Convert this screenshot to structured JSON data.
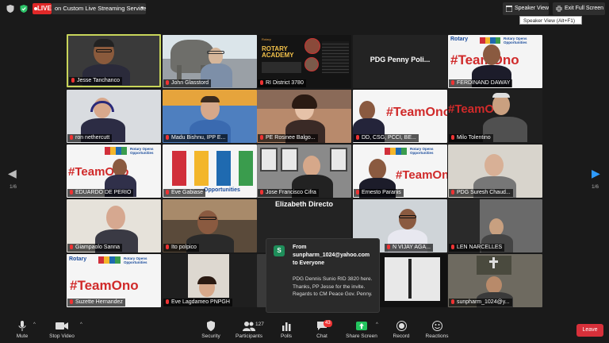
{
  "topbar": {
    "live_badge": "LIVE",
    "stream_label": "on Custom Live Streaming Service",
    "speaker_view_label": "Speaker View",
    "exit_full_screen_label": "Exit Full Screen",
    "tooltip": "Speaker View (Alt+F1)"
  },
  "gallery": {
    "page_left": "1/6",
    "page_right": "1/6",
    "tiles": [
      {
        "name": "Jesse Tanchanco"
      },
      {
        "name": "John Glasstord"
      },
      {
        "name": "RI District 3780"
      },
      {
        "name": "PDG Penny Poli..."
      },
      {
        "name": "FERDINAND DAWAY"
      },
      {
        "name": "ron nethercutt"
      },
      {
        "name": "Madu Bishnu, IPP E..."
      },
      {
        "name": "PE Rosinee Balgo..."
      },
      {
        "name": "DD, CSG, PCCI, BE..."
      },
      {
        "name": "Milo Tolentino"
      },
      {
        "name": "EDUARDO DE PERIO"
      },
      {
        "name": "Eve Gabiase"
      },
      {
        "name": "Jose Francisco Cifra"
      },
      {
        "name": "Ernesto Paranis"
      },
      {
        "name": "PDG Suresh Chaud..."
      },
      {
        "name": "Giampaolo Sanna"
      },
      {
        "name": "Ito polpico"
      },
      {
        "name": "Elizabeth Directo"
      },
      {
        "name": "N VIJAY AGA..."
      },
      {
        "name": "LEN NARCELLES"
      },
      {
        "name": "Suzette Hernandez"
      },
      {
        "name": "Eve Lagdameo PNPGH"
      },
      {
        "name": ""
      },
      {
        "name": ""
      },
      {
        "name": "sunpharm_1024@y..."
      }
    ],
    "team_ono": "#TeamOno",
    "rotary": "Rotary",
    "rotary_opens": "Rotary Opens Opportunities",
    "academy": "ROTARY ACADEMY",
    "opportunities": "Opportunities"
  },
  "chat": {
    "avatar_letter": "S",
    "from_label": "From",
    "sender": "sunpharm_1024@yahoo.com",
    "to": "to Everyone",
    "message": "PDG Dennis Sunio RID 3820 here. Thanks, PP Jesse for the invite. Regards to CM Peace Gov. Penny."
  },
  "toolbar": {
    "mute": "Mute",
    "stop_video": "Stop Video",
    "security": "Security",
    "participants": "Participants",
    "participants_count": "127",
    "polls": "Polls",
    "chat": "Chat",
    "chat_badge": "43",
    "share_screen": "Share Screen",
    "record": "Record",
    "reactions": "Reactions",
    "leave": "Leave"
  },
  "colors": {
    "live_red": "#e02828",
    "active_speaker_border": "#c8d55a",
    "share_green": "#23c45e",
    "leave_red": "#d7303a",
    "nav_blue": "#2e9bff"
  }
}
